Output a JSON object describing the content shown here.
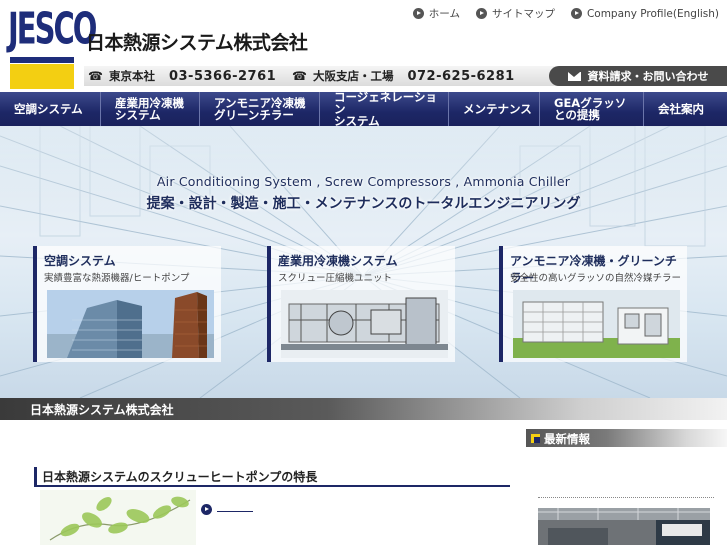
{
  "header": {
    "logo_text": "JESCO",
    "company_name": "日本熱源システム株式会社",
    "top_links": [
      {
        "label": "ホーム",
        "icon": "circle-arrow-icon"
      },
      {
        "label": "サイトマップ",
        "icon": "circle-arrow-icon"
      },
      {
        "label": "Company Profile(English)",
        "icon": "circle-arrow-icon"
      }
    ],
    "phones": [
      {
        "office": "東京本社",
        "number": "03-5366-2761",
        "icon": "phone-icon"
      },
      {
        "office": "大阪支店・工場",
        "number": "072-625-6281",
        "icon": "phone-icon"
      }
    ],
    "inquiry_label": "資料請求・お問い合わせ",
    "brand_colors": {
      "navy": "#1d2766",
      "yellow": "#f3cf12"
    }
  },
  "nav": {
    "items": [
      {
        "label": "空調システム"
      },
      {
        "label": "産業用冷凍機\nシステム"
      },
      {
        "label": "アンモニア冷凍機\nグリーンチラー"
      },
      {
        "label": "コージェネレーション\nシステム"
      },
      {
        "label": "メンテナンス"
      },
      {
        "label": "GEAグラッソ\nとの提携"
      },
      {
        "label": "会社案内"
      }
    ]
  },
  "hero": {
    "tagline_en": "Air Conditioning System , Screw Compressors , Ammonia Chiller",
    "tagline_jp": "提案・設計・製造・施工・メンテナンスのトータルエンジニアリング",
    "cards": [
      {
        "title": "空調システム",
        "subtitle": "実績豊富な熱源機器/ヒートポンプ"
      },
      {
        "title": "産業用冷凍機システム",
        "subtitle": "スクリュー圧縮機ユニット"
      },
      {
        "title": "アンモニア冷凍機・グリーンチラー",
        "subtitle": "安全性の高いグラッソの自然冷媒チラー"
      }
    ]
  },
  "section": {
    "title": "日本熱源システム株式会社"
  },
  "main": {
    "feature_title": "日本熱源システムのスクリューヒートポンプの特長",
    "news_title": "最新情報"
  }
}
